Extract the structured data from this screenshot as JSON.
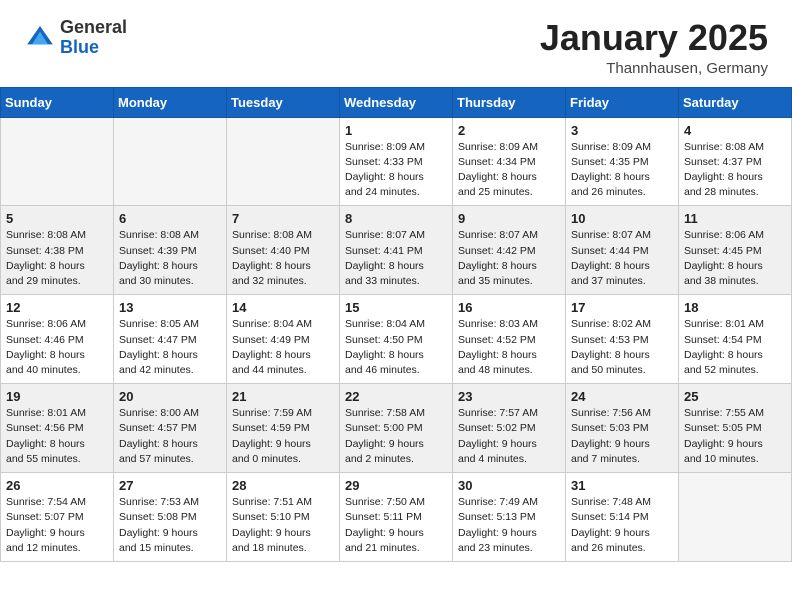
{
  "header": {
    "logo_general": "General",
    "logo_blue": "Blue",
    "month_title": "January 2025",
    "location": "Thannhausen, Germany"
  },
  "weekdays": [
    "Sunday",
    "Monday",
    "Tuesday",
    "Wednesday",
    "Thursday",
    "Friday",
    "Saturday"
  ],
  "weeks": [
    [
      {
        "day": "",
        "info": ""
      },
      {
        "day": "",
        "info": ""
      },
      {
        "day": "",
        "info": ""
      },
      {
        "day": "1",
        "info": "Sunrise: 8:09 AM\nSunset: 4:33 PM\nDaylight: 8 hours\nand 24 minutes."
      },
      {
        "day": "2",
        "info": "Sunrise: 8:09 AM\nSunset: 4:34 PM\nDaylight: 8 hours\nand 25 minutes."
      },
      {
        "day": "3",
        "info": "Sunrise: 8:09 AM\nSunset: 4:35 PM\nDaylight: 8 hours\nand 26 minutes."
      },
      {
        "day": "4",
        "info": "Sunrise: 8:08 AM\nSunset: 4:37 PM\nDaylight: 8 hours\nand 28 minutes."
      }
    ],
    [
      {
        "day": "5",
        "info": "Sunrise: 8:08 AM\nSunset: 4:38 PM\nDaylight: 8 hours\nand 29 minutes."
      },
      {
        "day": "6",
        "info": "Sunrise: 8:08 AM\nSunset: 4:39 PM\nDaylight: 8 hours\nand 30 minutes."
      },
      {
        "day": "7",
        "info": "Sunrise: 8:08 AM\nSunset: 4:40 PM\nDaylight: 8 hours\nand 32 minutes."
      },
      {
        "day": "8",
        "info": "Sunrise: 8:07 AM\nSunset: 4:41 PM\nDaylight: 8 hours\nand 33 minutes."
      },
      {
        "day": "9",
        "info": "Sunrise: 8:07 AM\nSunset: 4:42 PM\nDaylight: 8 hours\nand 35 minutes."
      },
      {
        "day": "10",
        "info": "Sunrise: 8:07 AM\nSunset: 4:44 PM\nDaylight: 8 hours\nand 37 minutes."
      },
      {
        "day": "11",
        "info": "Sunrise: 8:06 AM\nSunset: 4:45 PM\nDaylight: 8 hours\nand 38 minutes."
      }
    ],
    [
      {
        "day": "12",
        "info": "Sunrise: 8:06 AM\nSunset: 4:46 PM\nDaylight: 8 hours\nand 40 minutes."
      },
      {
        "day": "13",
        "info": "Sunrise: 8:05 AM\nSunset: 4:47 PM\nDaylight: 8 hours\nand 42 minutes."
      },
      {
        "day": "14",
        "info": "Sunrise: 8:04 AM\nSunset: 4:49 PM\nDaylight: 8 hours\nand 44 minutes."
      },
      {
        "day": "15",
        "info": "Sunrise: 8:04 AM\nSunset: 4:50 PM\nDaylight: 8 hours\nand 46 minutes."
      },
      {
        "day": "16",
        "info": "Sunrise: 8:03 AM\nSunset: 4:52 PM\nDaylight: 8 hours\nand 48 minutes."
      },
      {
        "day": "17",
        "info": "Sunrise: 8:02 AM\nSunset: 4:53 PM\nDaylight: 8 hours\nand 50 minutes."
      },
      {
        "day": "18",
        "info": "Sunrise: 8:01 AM\nSunset: 4:54 PM\nDaylight: 8 hours\nand 52 minutes."
      }
    ],
    [
      {
        "day": "19",
        "info": "Sunrise: 8:01 AM\nSunset: 4:56 PM\nDaylight: 8 hours\nand 55 minutes."
      },
      {
        "day": "20",
        "info": "Sunrise: 8:00 AM\nSunset: 4:57 PM\nDaylight: 8 hours\nand 57 minutes."
      },
      {
        "day": "21",
        "info": "Sunrise: 7:59 AM\nSunset: 4:59 PM\nDaylight: 9 hours\nand 0 minutes."
      },
      {
        "day": "22",
        "info": "Sunrise: 7:58 AM\nSunset: 5:00 PM\nDaylight: 9 hours\nand 2 minutes."
      },
      {
        "day": "23",
        "info": "Sunrise: 7:57 AM\nSunset: 5:02 PM\nDaylight: 9 hours\nand 4 minutes."
      },
      {
        "day": "24",
        "info": "Sunrise: 7:56 AM\nSunset: 5:03 PM\nDaylight: 9 hours\nand 7 minutes."
      },
      {
        "day": "25",
        "info": "Sunrise: 7:55 AM\nSunset: 5:05 PM\nDaylight: 9 hours\nand 10 minutes."
      }
    ],
    [
      {
        "day": "26",
        "info": "Sunrise: 7:54 AM\nSunset: 5:07 PM\nDaylight: 9 hours\nand 12 minutes."
      },
      {
        "day": "27",
        "info": "Sunrise: 7:53 AM\nSunset: 5:08 PM\nDaylight: 9 hours\nand 15 minutes."
      },
      {
        "day": "28",
        "info": "Sunrise: 7:51 AM\nSunset: 5:10 PM\nDaylight: 9 hours\nand 18 minutes."
      },
      {
        "day": "29",
        "info": "Sunrise: 7:50 AM\nSunset: 5:11 PM\nDaylight: 9 hours\nand 21 minutes."
      },
      {
        "day": "30",
        "info": "Sunrise: 7:49 AM\nSunset: 5:13 PM\nDaylight: 9 hours\nand 23 minutes."
      },
      {
        "day": "31",
        "info": "Sunrise: 7:48 AM\nSunset: 5:14 PM\nDaylight: 9 hours\nand 26 minutes."
      },
      {
        "day": "",
        "info": ""
      }
    ]
  ]
}
